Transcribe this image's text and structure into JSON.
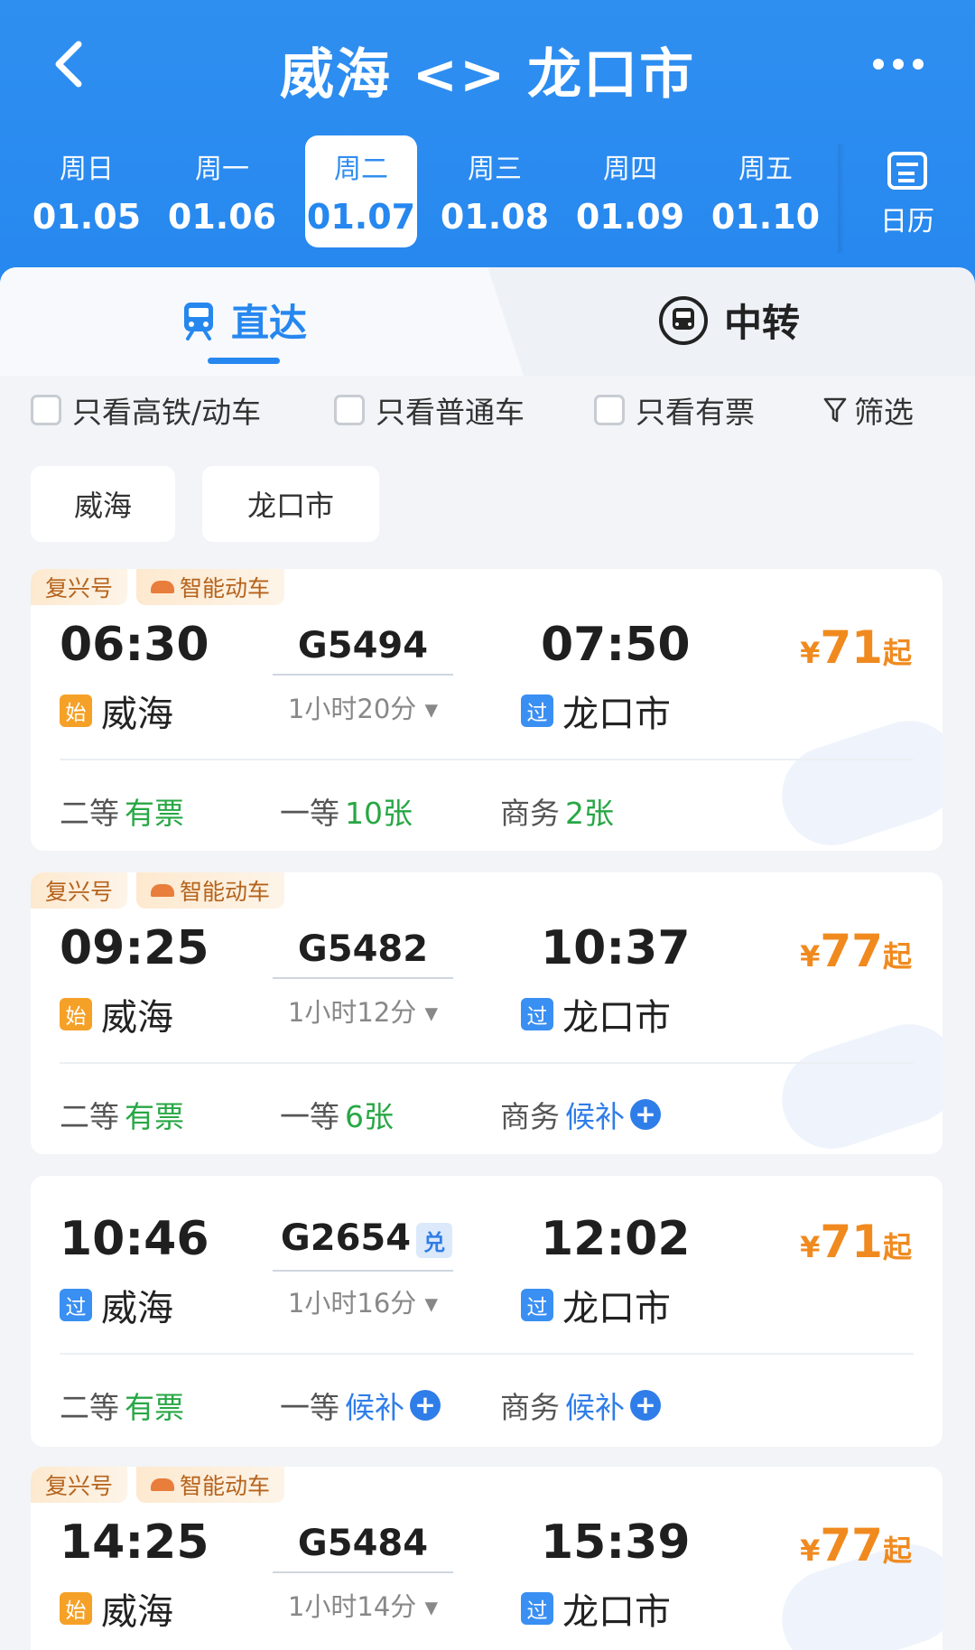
{
  "header": {
    "title": "威海 <> 龙口市",
    "dates": [
      {
        "weekday": "周日",
        "date": "01.05"
      },
      {
        "weekday": "周一",
        "date": "01.06"
      },
      {
        "weekday": "周二",
        "date": "01.07"
      },
      {
        "weekday": "周三",
        "date": "01.08"
      },
      {
        "weekday": "周四",
        "date": "01.09"
      },
      {
        "weekday": "周五",
        "date": "01.10"
      }
    ],
    "active_date_index": 2,
    "calendar_label": "日历"
  },
  "tabs": {
    "direct": "直达",
    "transfer": "中转"
  },
  "filters": {
    "high_speed": "只看高铁/动车",
    "normal": "只看普通车",
    "available": "只看有票",
    "filter_btn": "筛选"
  },
  "stations": [
    "威海",
    "龙口市"
  ],
  "trains": [
    {
      "badges": [
        "复兴号",
        "智能动车"
      ],
      "dep_time": "06:30",
      "arr_time": "07:50",
      "dep_tag": "始",
      "arr_tag": "过",
      "dep_station": "威海",
      "arr_station": "龙口市",
      "train_no": "G5494",
      "duration": "1小时20分",
      "price_yen": "¥",
      "price": "71",
      "price_suffix": "起",
      "seats": [
        {
          "class": "二等",
          "status": "有票",
          "type": "green"
        },
        {
          "class": "一等",
          "status": "10张",
          "type": "green"
        },
        {
          "class": "商务",
          "status": "2张",
          "type": "green"
        }
      ]
    },
    {
      "badges": [
        "复兴号",
        "智能动车"
      ],
      "dep_time": "09:25",
      "arr_time": "10:37",
      "dep_tag": "始",
      "arr_tag": "过",
      "dep_station": "威海",
      "arr_station": "龙口市",
      "train_no": "G5482",
      "duration": "1小时12分",
      "price_yen": "¥",
      "price": "77",
      "price_suffix": "起",
      "seats": [
        {
          "class": "二等",
          "status": "有票",
          "type": "green"
        },
        {
          "class": "一等",
          "status": "6张",
          "type": "green"
        },
        {
          "class": "商务",
          "status": "候补",
          "type": "blue"
        }
      ]
    },
    {
      "badges": [],
      "dep_time": "10:46",
      "arr_time": "12:02",
      "dep_tag": "过",
      "arr_tag": "过",
      "dep_station": "威海",
      "arr_station": "龙口市",
      "train_no": "G2654",
      "exchange": "兑",
      "duration": "1小时16分",
      "price_yen": "¥",
      "price": "71",
      "price_suffix": "起",
      "seats": [
        {
          "class": "二等",
          "status": "有票",
          "type": "green"
        },
        {
          "class": "一等",
          "status": "候补",
          "type": "blue"
        },
        {
          "class": "商务",
          "status": "候补",
          "type": "blue"
        }
      ]
    },
    {
      "badges": [
        "复兴号",
        "智能动车"
      ],
      "dep_time": "14:25",
      "arr_time": "15:39",
      "dep_tag": "始",
      "arr_tag": "过",
      "dep_station": "威海",
      "arr_station": "龙口市",
      "train_no": "G5484",
      "duration": "1小时14分",
      "price_yen": "¥",
      "price": "77",
      "price_suffix": "起",
      "seats": []
    }
  ]
}
